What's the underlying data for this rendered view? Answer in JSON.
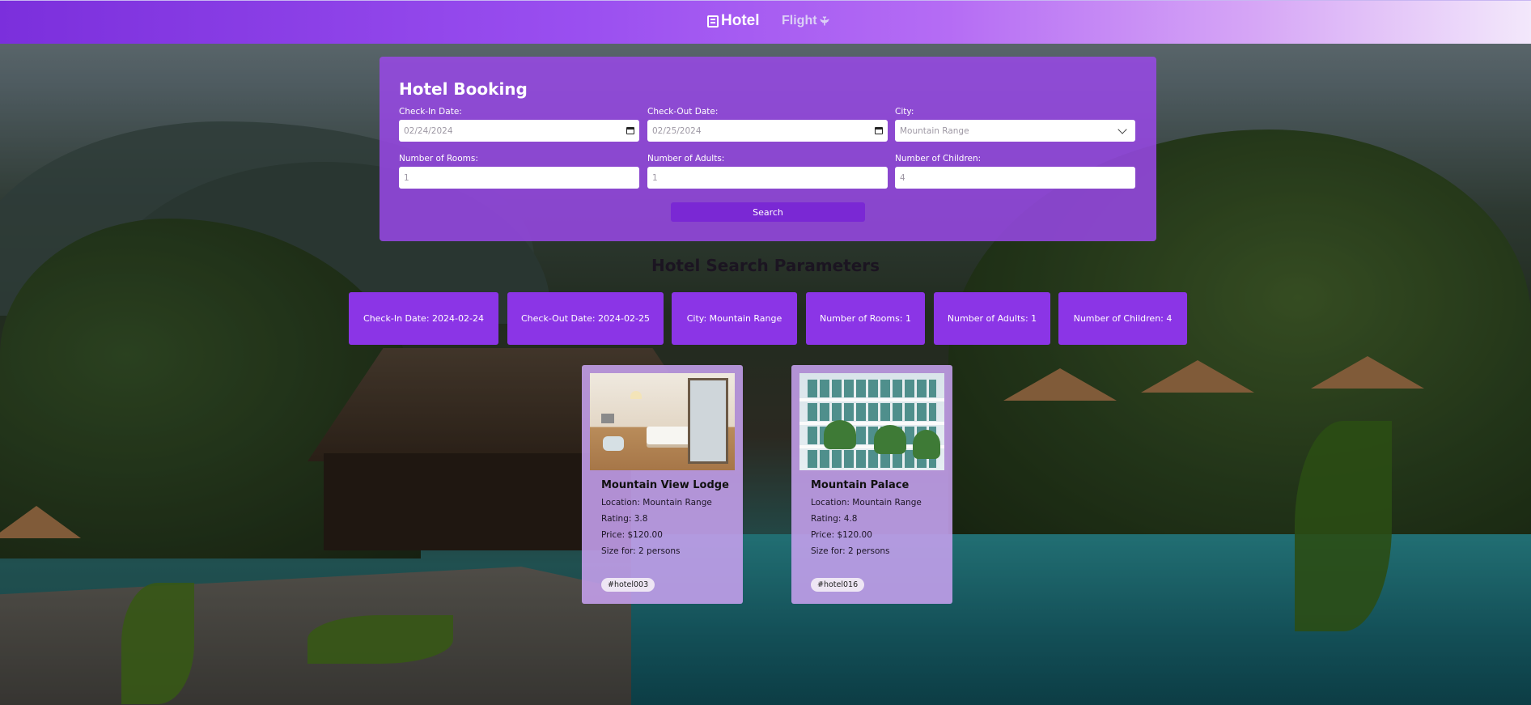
{
  "nav": {
    "hotel_label": "Hotel",
    "flight_label": "Flight",
    "hotel_icon": "hotel-icon",
    "flight_icon": "airplane-icon"
  },
  "booking": {
    "title": "Hotel Booking",
    "checkin_label": "Check-In Date:",
    "checkin_value": "02/24/2024",
    "checkout_label": "Check-Out Date:",
    "checkout_value": "02/25/2024",
    "city_label": "City:",
    "city_value": "Mountain Range",
    "rooms_label": "Number of Rooms:",
    "rooms_value": "1",
    "adults_label": "Number of Adults:",
    "adults_value": "1",
    "children_label": "Number of Children:",
    "children_value": "4",
    "search_label": "Search"
  },
  "params": {
    "title": "Hotel Search Parameters",
    "chips": [
      "Check-In Date: 2024-02-24",
      "Check-Out Date: 2024-02-25",
      "City: Mountain Range",
      "Number of Rooms: 1",
      "Number of Adults: 1",
      "Number of Children: 4"
    ]
  },
  "hotels": [
    {
      "name": "Mountain View Lodge",
      "location": "Location: Mountain Range",
      "rating": "Rating: 3.8",
      "price": "Price: $120.00",
      "size": "Size for: 2 persons",
      "tag": "#hotel003"
    },
    {
      "name": "Mountain Palace",
      "location": "Location: Mountain Range",
      "rating": "Rating: 4.8",
      "price": "Price: $120.00",
      "size": "Size for: 2 persons",
      "tag": "#hotel016"
    }
  ],
  "colors": {
    "accent": "#8b35e6",
    "panel": "#9848e6",
    "button": "#7a28d4",
    "card": "#c6a0ee"
  }
}
